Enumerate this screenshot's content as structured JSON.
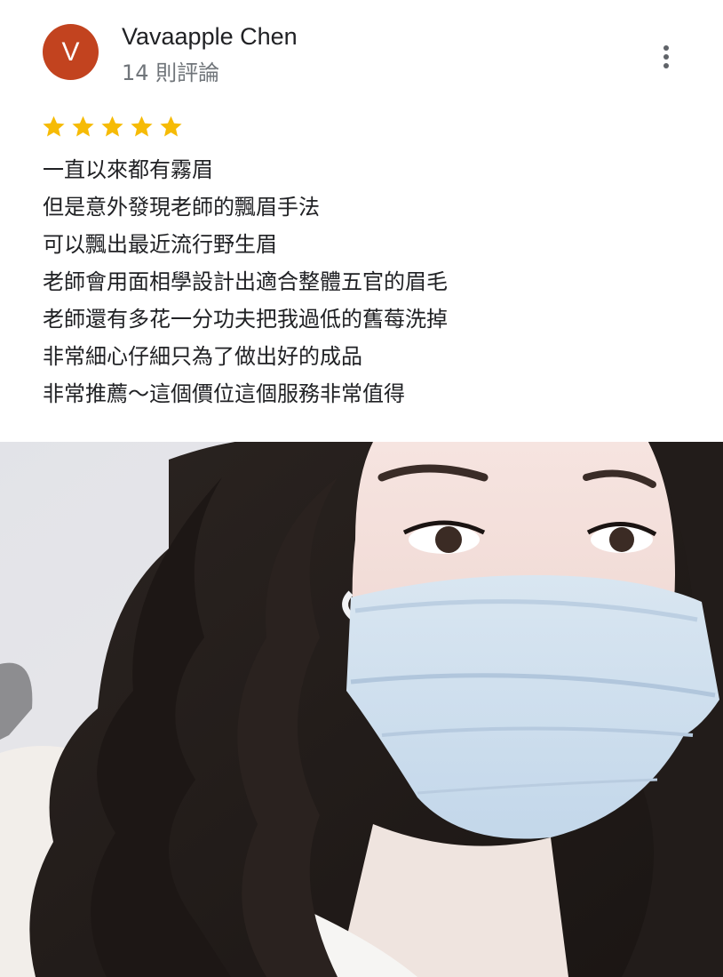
{
  "review": {
    "author": {
      "initial": "V",
      "name": "Vavaapple Chen",
      "review_count": "14 則評論",
      "avatar_color": "#c2431f"
    },
    "more_icon": "more-vert-icon",
    "rating": {
      "stars": 5,
      "max": 5,
      "star_color": "#f6bb06"
    },
    "text_lines": [
      "一直以來都有霧眉",
      "但是意外發現老師的飄眉手法",
      "可以飄出最近流行野生眉",
      "老師會用面相學設計出適合整體五官的眉毛",
      "老師還有多花一分功夫把我過低的舊莓洗掉",
      "非常細心仔細只為了做出好的成品",
      "非常推薦～這個價位這個服務非常值得"
    ]
  }
}
